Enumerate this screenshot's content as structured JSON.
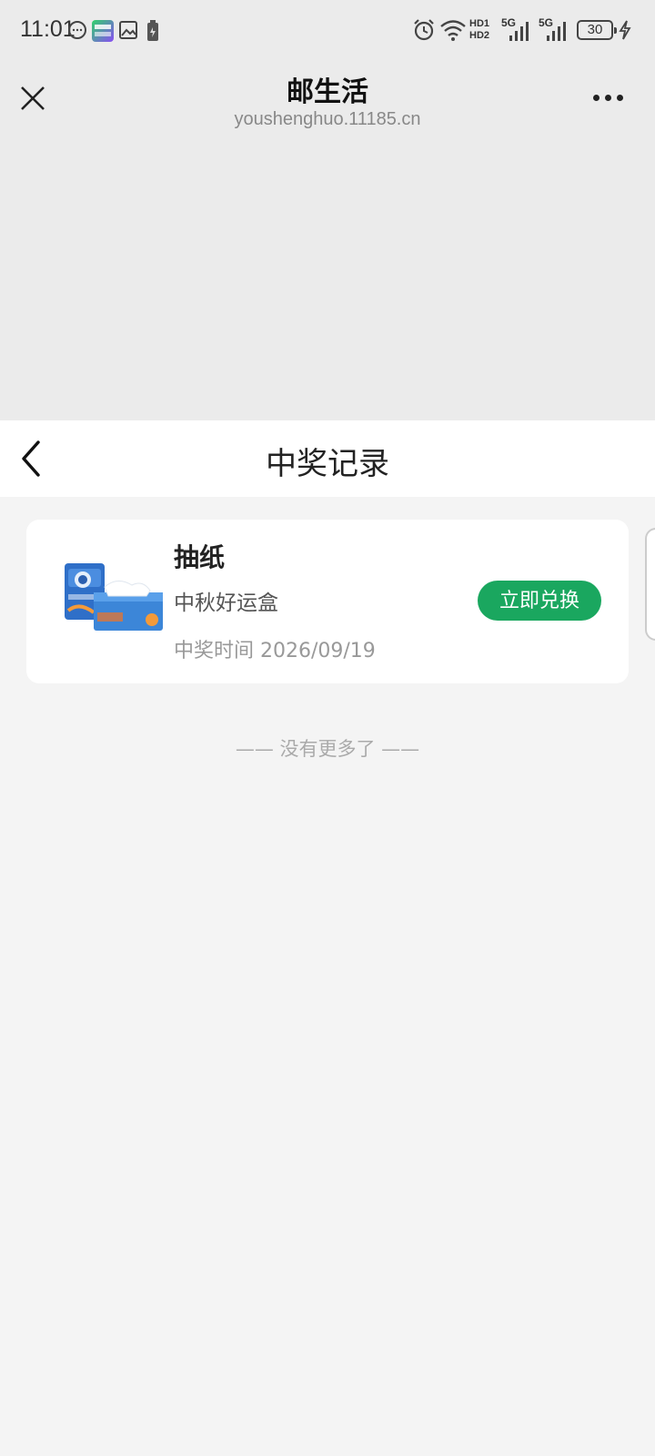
{
  "status_bar": {
    "time": "11:01",
    "left_icons": [
      "chat-bubble-icon",
      "iqiyi-app-icon",
      "gallery-icon",
      "battery-saver-icon"
    ],
    "right_icons": [
      "alarm-icon",
      "wifi-icon",
      "signal-icon",
      "signal-icon"
    ],
    "hd1": "HD1",
    "hd2": "HD2",
    "net1": "5G",
    "net2": "5G",
    "battery": "30",
    "charging_icon": "bolt-icon"
  },
  "mini_program": {
    "title": "邮生活",
    "url": "youshenghuo.11185.cn",
    "close_icon": "close-icon",
    "more_icon": "more-icon"
  },
  "page": {
    "title": "中奖记录",
    "back_icon": "chevron-left-icon"
  },
  "records": [
    {
      "name": "抽纸",
      "source": "中秋好运盒",
      "time": "中奖时间 2026/09/19",
      "action": "立即兑换"
    }
  ],
  "footer": {
    "no_more": "—— 没有更多了 ——"
  },
  "colors": {
    "accent": "#1aa75f",
    "header_bg": "#ebebeb",
    "page_bg": "#f4f4f4"
  }
}
